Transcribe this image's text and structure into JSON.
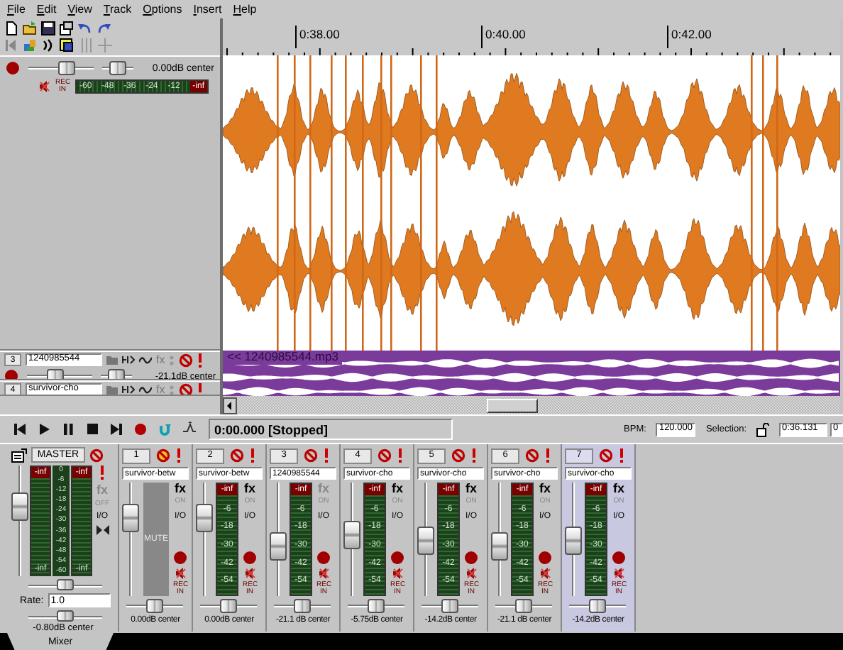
{
  "menu": [
    "File",
    "Edit",
    "View",
    "Track",
    "Options",
    "Insert",
    "Help"
  ],
  "tracks": [
    {
      "kind": "main",
      "record_armed": true,
      "volume": {
        "level": 0.62
      },
      "pan": {
        "level": 0.5
      },
      "reading": "0.00dB center",
      "rec_in": "REC IN",
      "meter_labels": [
        "-60",
        "-48",
        "-36",
        "-24",
        "-12",
        "-inf"
      ]
    },
    {
      "kind": "compact",
      "number": "3",
      "name": "1240985544",
      "fx": "fx",
      "record_armed": true,
      "volume": {
        "level": 0.4
      },
      "pan": {
        "level": 0.5
      },
      "reading": "-21.1dB center"
    },
    {
      "kind": "compact",
      "number": "4",
      "name": "survivor-cho",
      "fx": "fx"
    }
  ],
  "arrange": {
    "ruler": [
      "0:38.00",
      "0:40.00",
      "0:42.00"
    ],
    "item_label": "<< 1240985544.mp3"
  },
  "transport": {
    "time": "0:00.000 [Stopped]",
    "bpm_label": "BPM:",
    "bpm": "120.000",
    "selection_label": "Selection:",
    "selection_start": "0:36.131",
    "selection_end": "0"
  },
  "mixer": {
    "master": {
      "label": "MASTER",
      "fader": {
        "level": 0.68
      },
      "meters": [
        {
          "peak": "-inf",
          "floor": "-inf"
        },
        {
          "peak": "-inf",
          "floor": "-inf"
        }
      ],
      "scale": [
        "0",
        "-6",
        "-12",
        "-18",
        "-24",
        "-30",
        "-36",
        "-42",
        "-48",
        "-54",
        "-60"
      ],
      "fx": "fx",
      "fx_state": "OFF",
      "fx_active": false,
      "io": "I/O",
      "pan": {
        "level": 0.5
      },
      "rate_label": "Rate:",
      "rate": "1.0",
      "width": {
        "level": 0.5
      },
      "reading": "-0.80dB center"
    },
    "strips": [
      {
        "number": "1",
        "name": "survivor-betw",
        "selected": false,
        "muted": true,
        "mute_label": "MUTE",
        "fader": {
          "level": 0.75
        },
        "fx": "fx",
        "fx_state": "ON",
        "fx_active": true,
        "io": "I/O",
        "rec_in": "REC IN",
        "pan": {
          "level": 0.5
        },
        "reading": "0.00dB center"
      },
      {
        "number": "2",
        "name": "survivor-betw",
        "selected": false,
        "muted": false,
        "fader": {
          "level": 0.75
        },
        "meter_labels": [
          "-inf",
          "-6",
          "-18",
          "-30",
          "-42",
          "-54"
        ],
        "fx": "fx",
        "fx_state": "ON",
        "fx_active": true,
        "io": "I/O",
        "rec_in": "REC IN",
        "pan": {
          "level": 0.5
        },
        "reading": "0.00dB center"
      },
      {
        "number": "3",
        "name": "1240985544",
        "selected": false,
        "muted": false,
        "fader": {
          "level": 0.42
        },
        "meter_labels": [
          "-inf",
          "-6",
          "-18",
          "-30",
          "-42",
          "-54"
        ],
        "fx": "fx",
        "fx_state": "ON",
        "fx_active": false,
        "io": "I/O",
        "rec_in": "REC IN",
        "pan": {
          "level": 0.5
        },
        "reading": "-21.1 dB center"
      },
      {
        "number": "4",
        "name": "survivor-cho",
        "selected": false,
        "muted": false,
        "fader": {
          "level": 0.55
        },
        "meter_labels": [
          "-inf",
          "-6",
          "-18",
          "-30",
          "-42",
          "-54"
        ],
        "fx": "fx",
        "fx_state": "ON",
        "fx_active": true,
        "io": "I/O",
        "rec_in": "REC IN",
        "pan": {
          "level": 0.5
        },
        "reading": "-5.75dB center"
      },
      {
        "number": "5",
        "name": "survivor-cho",
        "selected": false,
        "muted": false,
        "fader": {
          "level": 0.48
        },
        "meter_labels": [
          "-inf",
          "-6",
          "-18",
          "-30",
          "-42",
          "-54"
        ],
        "fx": "fx",
        "fx_state": "ON",
        "fx_active": true,
        "io": "I/O",
        "rec_in": "REC IN",
        "pan": {
          "level": 0.5
        },
        "reading": "-14.2dB center"
      },
      {
        "number": "6",
        "name": "survivor-cho",
        "selected": false,
        "muted": false,
        "fader": {
          "level": 0.42
        },
        "meter_labels": [
          "-inf",
          "-6",
          "-18",
          "-30",
          "-42",
          "-54"
        ],
        "fx": "fx",
        "fx_state": "ON",
        "fx_active": true,
        "io": "I/O",
        "rec_in": "REC IN",
        "pan": {
          "level": 0.5
        },
        "reading": "-21.1 dB center"
      },
      {
        "number": "7",
        "name": "survivor-cho",
        "selected": true,
        "muted": false,
        "fader": {
          "level": 0.48
        },
        "meter_labels": [
          "-inf",
          "-6",
          "-18",
          "-30",
          "-42",
          "-54"
        ],
        "fx": "fx",
        "fx_state": "ON",
        "fx_active": true,
        "io": "I/O",
        "rec_in": "REC IN",
        "pan": {
          "level": 0.5
        },
        "reading": "-14.2dB center"
      }
    ]
  },
  "tabs": [
    {
      "label": "Mixer",
      "selected": true
    }
  ]
}
